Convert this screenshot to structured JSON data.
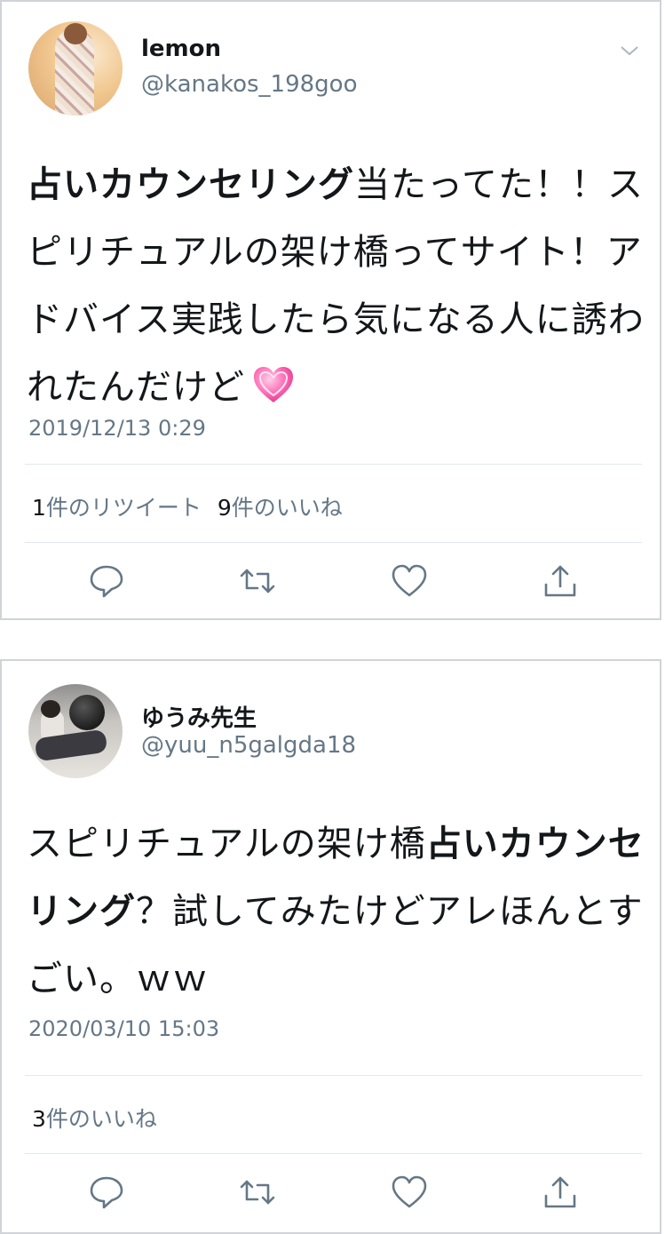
{
  "tweets": [
    {
      "name": "lemon",
      "handle": "@kanakos_198goo",
      "text": {
        "bold_1": "占いカウンセリング",
        "rest_1": "当たってた！！スピリチュアルの架け橋ってサイト！アドバイス実践したら気になる人に誘われたんだけど"
      },
      "emoji": "growing-heart-emoji",
      "timestamp": "2019/12/13 0:29",
      "stats": {
        "retweet_count": "1",
        "retweet_label": "件のリツイート",
        "like_count": "9",
        "like_label": "件のいいね"
      }
    },
    {
      "name": "ゆうみ先生",
      "handle": "@yuu_n5galgda18",
      "text": {
        "plain_1": "スピリチュアルの架け橋",
        "bold_1": "占いカウンセリング",
        "rest_1": "？試してみたけどアレほんとすごい。ｗｗ"
      },
      "timestamp": "2020/03/10 15:03",
      "stats": {
        "like_count": "3",
        "like_label": "件のいいね"
      }
    }
  ],
  "icons": [
    "chevron-down-icon",
    "reply-icon",
    "retweet-icon",
    "like-icon",
    "share-icon"
  ],
  "colors": {
    "text": "#14171a",
    "secondary": "#657786",
    "divider": "#e1e8ed",
    "icon": "#657786"
  }
}
